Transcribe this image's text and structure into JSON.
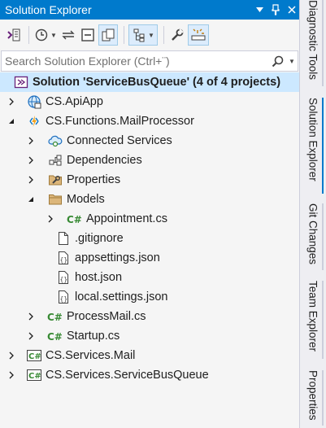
{
  "window": {
    "title": "Solution Explorer"
  },
  "search": {
    "placeholder": "Search Solution Explorer (Ctrl+¨)"
  },
  "tree": {
    "solution": "Solution 'ServiceBusQueue' (4 of 4 projects)",
    "items": [
      "CS.ApiApp",
      "CS.Functions.MailProcessor",
      "Connected Services",
      "Dependencies",
      "Properties",
      "Models",
      "Appointment.cs",
      ".gitignore",
      "appsettings.json",
      "host.json",
      "local.settings.json",
      "ProcessMail.cs",
      "Startup.cs",
      "CS.Services.Mail",
      "CS.Services.ServiceBusQueue"
    ]
  },
  "side_tabs": [
    "Diagnostic Tools",
    "Solution Explorer",
    "Git Changes",
    "Team Explorer",
    "Properties"
  ],
  "colors": {
    "accent": "#007acc",
    "selected_row": "#cce8ff",
    "csharp_green": "#388a34"
  }
}
